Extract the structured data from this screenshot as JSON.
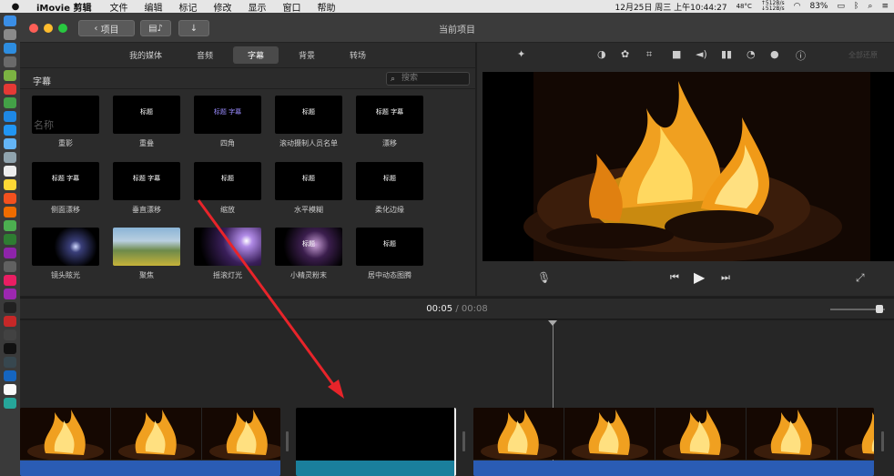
{
  "menubar": {
    "app_name": "iMovie 剪辑",
    "items": [
      "文件",
      "编辑",
      "标记",
      "修改",
      "显示",
      "窗口",
      "帮助"
    ],
    "temp": "48°C",
    "net_up": "↑512B/s",
    "net_down": "↓512B/s",
    "battery": "83%",
    "datetime": "12月25日 周三 上午10:44:27"
  },
  "window": {
    "title": "当前项目",
    "back_label": "项目"
  },
  "browser": {
    "tabs": [
      "我的媒体",
      "音频",
      "字幕",
      "背景",
      "转场"
    ],
    "active_tab": 2,
    "section_title": "字幕",
    "search_placeholder": "搜索",
    "tiles": [
      {
        "name": "重影",
        "preview": "名称"
      },
      {
        "name": "重叠",
        "preview": "标题"
      },
      {
        "name": "四角",
        "preview": "标题 字幕"
      },
      {
        "name": "滚动摄制人员名单",
        "preview": "标题"
      },
      {
        "name": "漂移",
        "preview": "标题 字幕"
      },
      {
        "name": "侧面漂移",
        "preview": "标题 字幕"
      },
      {
        "name": "垂直漂移",
        "preview": "标题 字幕"
      },
      {
        "name": "缩放",
        "preview": "标题"
      },
      {
        "name": "水平模糊",
        "preview": "标题"
      },
      {
        "name": "柔化边缘",
        "preview": "标题"
      },
      {
        "name": "镜头眩光",
        "preview": ""
      },
      {
        "name": "聚焦",
        "preview": ""
      },
      {
        "name": "摇滚灯光",
        "preview": ""
      },
      {
        "name": "小精灵粉末",
        "preview": "标题"
      },
      {
        "name": "居中动态图腾",
        "preview": "标题"
      }
    ]
  },
  "viewer": {
    "reset_label": "全部还原"
  },
  "timebar": {
    "current": "00:05",
    "separator": "/",
    "total": "00:08"
  },
  "colors": {
    "accent": "#2a5cb4",
    "title_clip": "#1a7f9c",
    "arrow": "#e8242a"
  }
}
